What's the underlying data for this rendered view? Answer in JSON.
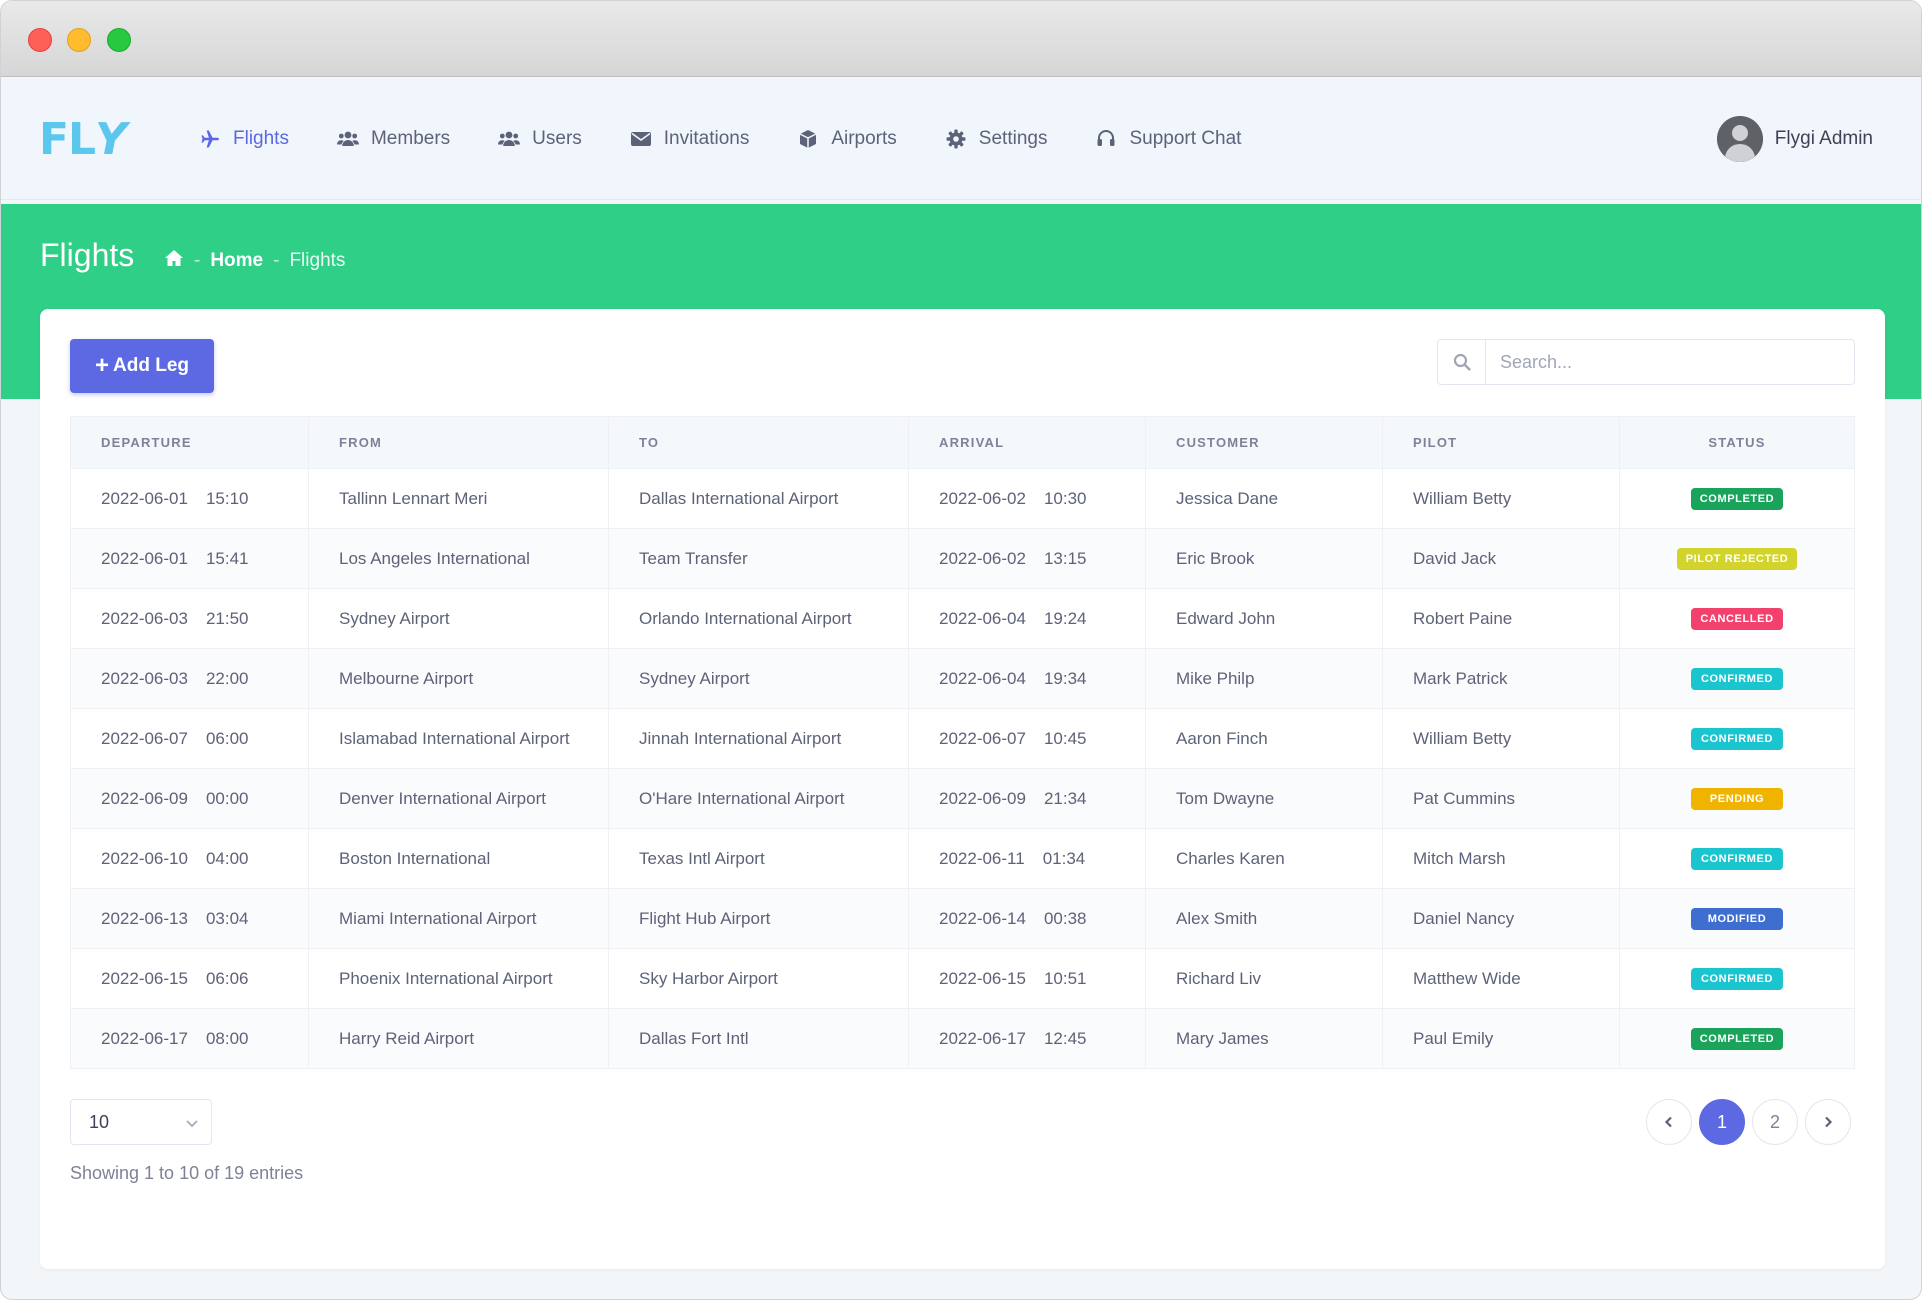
{
  "logo": {
    "text_a": "FL",
    "text_b": "Y"
  },
  "nav": [
    {
      "label": "Flights",
      "icon": "plane-icon",
      "active": true
    },
    {
      "label": "Members",
      "icon": "users-icon"
    },
    {
      "label": "Users",
      "icon": "users-icon"
    },
    {
      "label": "Invitations",
      "icon": "envelope-icon"
    },
    {
      "label": "Airports",
      "icon": "box-icon"
    },
    {
      "label": "Settings",
      "icon": "gear-icon"
    },
    {
      "label": "Support Chat",
      "icon": "headset-icon"
    }
  ],
  "user": {
    "name": "Flygi Admin"
  },
  "page": {
    "title": "Flights",
    "breadcrumb_home": "Home",
    "breadcrumb_current": "Flights",
    "breadcrumb_sep": "-"
  },
  "toolbar": {
    "add_label": "Add Leg",
    "search_placeholder": "Search..."
  },
  "table": {
    "headers": [
      "DEPARTURE",
      "FROM",
      "TO",
      "ARRIVAL",
      "CUSTOMER",
      "PILOT",
      "STATUS"
    ],
    "rows": [
      {
        "dep_date": "2022-06-01",
        "dep_time": "15:10",
        "from": "Tallinn Lennart Meri",
        "to": "Dallas International Airport",
        "arr_date": "2022-06-02",
        "arr_time": "10:30",
        "customer": "Jessica Dane",
        "pilot": "William Betty",
        "status": "COMPLETED"
      },
      {
        "dep_date": "2022-06-01",
        "dep_time": "15:41",
        "from": "Los Angeles International",
        "to": "Team Transfer",
        "arr_date": "2022-06-02",
        "arr_time": "13:15",
        "customer": "Eric Brook",
        "pilot": "David Jack",
        "status": "PILOT REJECTED"
      },
      {
        "dep_date": "2022-06-03",
        "dep_time": "21:50",
        "from": "Sydney Airport",
        "to": "Orlando International Airport",
        "arr_date": "2022-06-04",
        "arr_time": "19:24",
        "customer": "Edward John",
        "pilot": "Robert Paine",
        "status": "CANCELLED"
      },
      {
        "dep_date": "2022-06-03",
        "dep_time": "22:00",
        "from": "Melbourne Airport",
        "to": "Sydney Airport",
        "arr_date": "2022-06-04",
        "arr_time": "19:34",
        "customer": "Mike Philp",
        "pilot": "Mark Patrick",
        "status": "CONFIRMED"
      },
      {
        "dep_date": "2022-06-07",
        "dep_time": "06:00",
        "from": "Islamabad International Airport",
        "to": "Jinnah International Airport",
        "arr_date": "2022-06-07",
        "arr_time": "10:45",
        "customer": "Aaron Finch",
        "pilot": "William Betty",
        "status": "CONFIRMED"
      },
      {
        "dep_date": "2022-06-09",
        "dep_time": "00:00",
        "from": "Denver International Airport",
        "to": "O'Hare International Airport",
        "arr_date": "2022-06-09",
        "arr_time": "21:34",
        "customer": "Tom Dwayne",
        "pilot": "Pat Cummins",
        "status": "PENDING"
      },
      {
        "dep_date": "2022-06-10",
        "dep_time": "04:00",
        "from": "Boston International",
        "to": "Texas Intl Airport",
        "arr_date": "2022-06-11",
        "arr_time": "01:34",
        "customer": "Charles Karen",
        "pilot": "Mitch Marsh",
        "status": "CONFIRMED"
      },
      {
        "dep_date": "2022-06-13",
        "dep_time": "03:04",
        "from": "Miami International Airport",
        "to": "Flight Hub Airport",
        "arr_date": "2022-06-14",
        "arr_time": "00:38",
        "customer": "Alex Smith",
        "pilot": "Daniel Nancy",
        "status": "MODIFIED"
      },
      {
        "dep_date": "2022-06-15",
        "dep_time": "06:06",
        "from": "Phoenix International Airport",
        "to": "Sky Harbor Airport",
        "arr_date": "2022-06-15",
        "arr_time": "10:51",
        "customer": "Richard Liv",
        "pilot": "Matthew Wide",
        "status": "CONFIRMED"
      },
      {
        "dep_date": "2022-06-17",
        "dep_time": "08:00",
        "from": "Harry Reid Airport",
        "to": "Dallas Fort Intl",
        "arr_date": "2022-06-17",
        "arr_time": "12:45",
        "customer": "Mary James",
        "pilot": "Paul Emily",
        "status": "COMPLETED"
      }
    ]
  },
  "status_colors": {
    "COMPLETED": "#1aa35a",
    "PILOT REJECTED": "#d2d42b",
    "CANCELLED": "#f1416c",
    "CONFIRMED": "#1bc5d0",
    "PENDING": "#f0b400",
    "MODIFIED": "#3e6fd0"
  },
  "footer": {
    "per_page": "10",
    "showing": "Showing 1 to 10 of 19 entries",
    "pages": [
      "1",
      "2"
    ],
    "current_page": "1"
  },
  "colors": {
    "accent": "#5d69e3",
    "band": "#2fcf87",
    "logo": "#5cc7ec"
  }
}
